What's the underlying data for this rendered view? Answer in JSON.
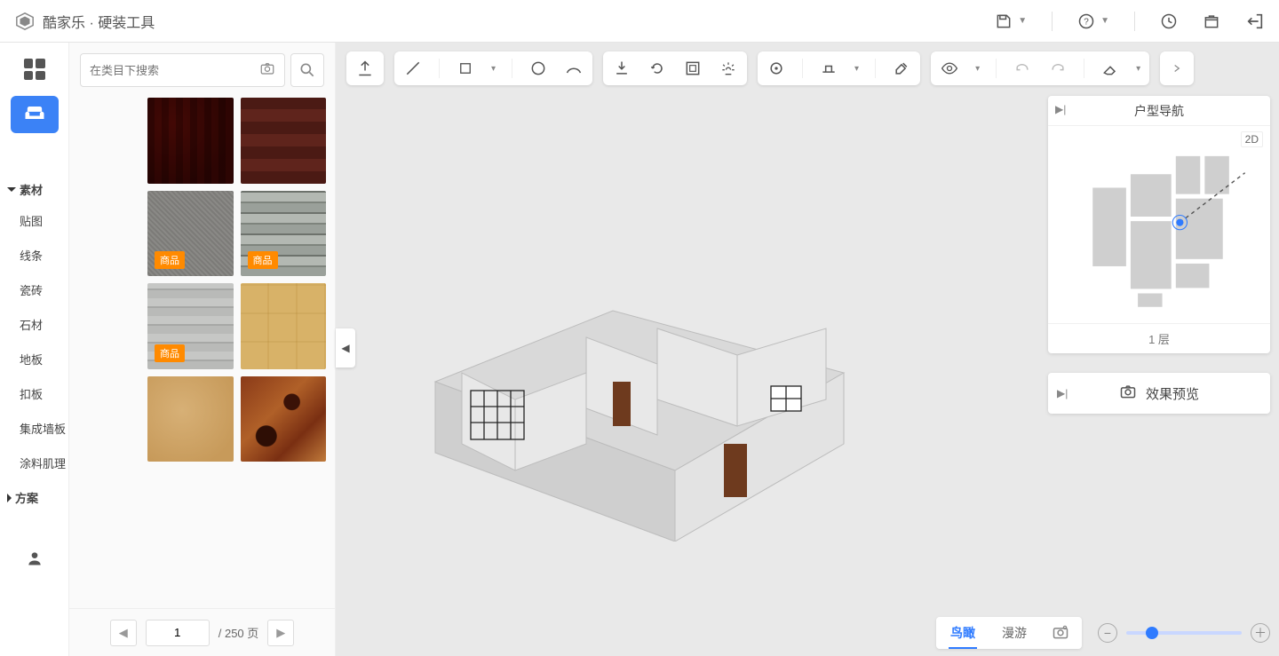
{
  "brand": {
    "name": "酷家乐",
    "suffix": "· 硬装工具"
  },
  "top_actions": {
    "save": "save",
    "help": "help",
    "history": "history",
    "package": "package",
    "exit": "exit"
  },
  "rail": {
    "grid": "dashboard",
    "library": "素材库",
    "user": "user"
  },
  "search": {
    "placeholder": "在类目下搜索"
  },
  "categories": {
    "section_material": "素材",
    "items": [
      "贴图",
      "线条",
      "瓷砖",
      "石材",
      "地板",
      "扣板",
      "集成墙板",
      "涂料肌理"
    ],
    "section_scheme": "方案"
  },
  "tiles": [
    {
      "style": "wood-red",
      "badge": null
    },
    {
      "style": "wood-red2",
      "badge": null
    },
    {
      "style": "fabric-grey",
      "badge": "商品"
    },
    {
      "style": "stone-strip",
      "badge": "商品"
    },
    {
      "style": "stone-grey",
      "badge": "商品"
    },
    {
      "style": "wood-light",
      "badge": null
    },
    {
      "style": "sand",
      "badge": null
    },
    {
      "style": "rust",
      "badge": null
    }
  ],
  "pager": {
    "current": "1",
    "total_label": "/ 250 页"
  },
  "nav_panel": {
    "title": "户型导航",
    "badge_2d": "2D",
    "floor_label": "1 层"
  },
  "effect_panel": {
    "label": "效果预览"
  },
  "view_tabs": {
    "bird": "鸟瞰",
    "walk": "漫游"
  },
  "colors": {
    "accent": "#2f7bff",
    "badge": "#ff8a00"
  }
}
